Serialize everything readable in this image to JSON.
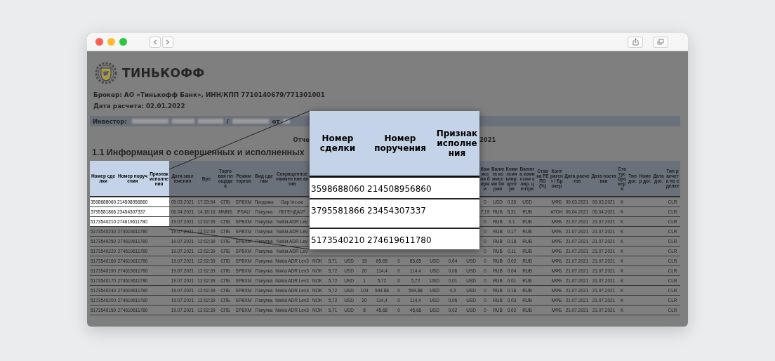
{
  "document": {
    "brand": "ТИНЬКОФФ",
    "broker": "Брокер: АО «Тинькофф Банк», ИНН/КПП 7710140679/771301001",
    "settlement_date": "Дата расчета: 02.01.2022",
    "investor": {
      "label": "Инвестор:",
      "separator": "/",
      "from": "от"
    },
    "report_title_start": "Отче",
    "report_title_end": "2021",
    "section_heading": "1.1 Информация о совершенных и исполненных"
  },
  "table": {
    "header": {
      "highlighted": true,
      "deal": "Номер сделки",
      "order": "Номер поручения",
      "sign": "Признак исполнения",
      "date": "Дата заключения",
      "time": "Вре",
      "venue": "Торговая площадка",
      "mode": "Режим торгов",
      "side": "Вид сделки",
      "asset": "Сокращенное наимен ние актив",
      "exch_fee": "Комиссия биржи",
      "exch_cur": "Валюта комиссии биржи",
      "clr_fee": "Комиссия клир. центра",
      "clr_cur": "Валюта комиссии клир. центра",
      "repo": "Ставка РЕПО (%)",
      "counterparty": "Контрагент / Брокер",
      "settle_date": "Дата расчетов",
      "delivery_date": "Дата поставки",
      "status": "Статус брокера",
      "contract_type": "Тип дог.",
      "contract_no": "Номер дог.",
      "contract_date": "Дата дог.",
      "settle_type": "Тип расчета по сделке"
    },
    "rows": [
      {
        "highlighted": true,
        "deal": "3598688060",
        "order": "214508956860",
        "date": "05.03.2021",
        "time": "17:33:54",
        "venue": "СПБ",
        "mode": "SPBXM",
        "side": "Продажа",
        "asset": "Gap Inc-ao",
        "exch_fee": "0",
        "exch_cur": "USD",
        "clr_fee": "0.35",
        "clr_cur": "USD",
        "counterparty": "МФБ",
        "settle_date": "09.03.2021",
        "delivery_date": "09.03.2021",
        "status": "К",
        "settle_type": "CLR"
      },
      {
        "highlighted": true,
        "deal": "3795581866",
        "order": "23454307337",
        "date": "06.04.2021",
        "time": "14:18:16",
        "venue": "ММВБ",
        "mode": "PSAU",
        "side": "Покупка",
        "asset": "ЛЕГЕНДА1Р",
        "exch_fee": "7.19",
        "exch_cur": "RUB",
        "clr_fee": "5.31",
        "clr_cur": "RUB",
        "counterparty": "АТОН",
        "settle_date": "06.04.2021",
        "delivery_date": "06.04.2021",
        "status": "К",
        "settle_type": "CLR"
      },
      {
        "highlighted": true,
        "deal": "5173540210",
        "order": "274619611780",
        "date": "19.07.2021",
        "time": "12:02:39",
        "venue": "СПБ",
        "mode": "SPBXM",
        "side": "Покупка",
        "asset": "Nokia ADR Lev",
        "exch_fee": "0",
        "exch_cur": "RUB",
        "clr_fee": "0.1",
        "clr_cur": "RUB",
        "counterparty": "МФБ",
        "settle_date": "21.07.2021",
        "delivery_date": "21.07.2021",
        "status": "К",
        "settle_type": "CLR"
      },
      {
        "highlighted": false,
        "deal": "5173540230",
        "order": "274619611780",
        "date": "19.07.2021",
        "time": "12:02:39",
        "venue": "СПБ",
        "mode": "SPBXM",
        "side": "Покупка",
        "asset": "Nokia ADR Lev",
        "exch_fee": "0",
        "exch_cur": "RUB",
        "clr_fee": "0.17",
        "clr_cur": "RUB",
        "counterparty": "МФБ",
        "settle_date": "21.07.2021",
        "delivery_date": "21.07.2021",
        "status": "К",
        "settle_type": "CLR"
      },
      {
        "highlighted": false,
        "deal": "5173540250",
        "order": "274619611780",
        "date": "19.07.2021",
        "time": "12:02:39",
        "venue": "СПБ",
        "mode": "SPBXM",
        "side": "Покупка",
        "asset": "Nokia ADR Lev",
        "exch_fee": "0",
        "exch_cur": "RUB",
        "clr_fee": "0.18",
        "clr_cur": "RUB",
        "counterparty": "МФБ",
        "settle_date": "21.07.2021",
        "delivery_date": "21.07.2021",
        "status": "К",
        "settle_type": "CLR"
      },
      {
        "highlighted": false,
        "deal": "5173540220",
        "order": "274619611780",
        "date": "19.07.2021",
        "time": "12:02:39",
        "venue": "СПБ",
        "mode": "SPBXM",
        "side": "Покупка",
        "asset": "Nokia ADR Lev",
        "exch_fee": "0",
        "exch_cur": "RUB",
        "clr_fee": "0.11",
        "clr_cur": "RUB",
        "counterparty": "МФБ",
        "settle_date": "21.07.2021",
        "delivery_date": "21.07.2021",
        "status": "К",
        "settle_type": "CLR"
      },
      {
        "highlighted": false,
        "deal": "5173540160",
        "order": "274619611780",
        "date": "19.07.2021",
        "time": "12:02:39",
        "venue": "СПБ",
        "mode": "SPBXM",
        "side": "Покупка",
        "asset": "Nokia ADR Lev3",
        "code": "NOK",
        "price": "5,71",
        "price_cur": "USD",
        "qty": "15",
        "amount": "85,65",
        "nkd": "0",
        "deal_sum": "85,65",
        "settle_cur": "USD",
        "broker_fee": "0,04",
        "broker_fee_cur": "USD",
        "exch_fee": "0",
        "exch_cur": "RUB",
        "clr_fee": "0.02",
        "clr_cur": "RUB",
        "counterparty": "МФБ",
        "settle_date": "21.07.2021",
        "delivery_date": "21.07.2021",
        "status": "К",
        "settle_type": "CLR"
      },
      {
        "highlighted": false,
        "deal": "5173540190",
        "order": "274619611780",
        "date": "19.07.2021",
        "time": "12:02:39",
        "venue": "СПБ",
        "mode": "SPBXM",
        "side": "Покупка",
        "asset": "Nokia ADR Lev3",
        "code": "NOK",
        "price": "5,72",
        "price_cur": "USD",
        "qty": "20",
        "amount": "114,4",
        "nkd": "0",
        "deal_sum": "114,4",
        "settle_cur": "USD",
        "broker_fee": "0,06",
        "broker_fee_cur": "USD",
        "exch_fee": "0",
        "exch_cur": "RUB",
        "clr_fee": "0.04",
        "clr_cur": "RUB",
        "counterparty": "МФБ",
        "settle_date": "21.07.2021",
        "delivery_date": "21.07.2021",
        "status": "К",
        "settle_type": "CLR"
      },
      {
        "highlighted": false,
        "deal": "5173540170",
        "order": "274619611780",
        "date": "19.07.2021",
        "time": "12:02:39",
        "venue": "СПБ",
        "mode": "SPBXM",
        "side": "Покупка",
        "asset": "Nokia ADR Lev3",
        "code": "NOK",
        "price": "5,72",
        "price_cur": "USD",
        "qty": "1",
        "amount": "5,72",
        "nkd": "0",
        "deal_sum": "5,72",
        "settle_cur": "USD",
        "broker_fee": "0,01",
        "broker_fee_cur": "USD",
        "exch_fee": "0",
        "exch_cur": "RUB",
        "clr_fee": "0.01",
        "clr_cur": "RUB",
        "counterparty": "МФБ",
        "settle_date": "21.07.2021",
        "delivery_date": "21.07.2021",
        "status": "К",
        "settle_type": "CLR"
      },
      {
        "highlighted": false,
        "deal": "5173540240",
        "order": "274619611780",
        "date": "19.07.2021",
        "time": "12:02:39",
        "venue": "СПБ",
        "mode": "SPBXM",
        "side": "Покупка",
        "asset": "Nokia ADR Lev3",
        "code": "NOK",
        "price": "5,72",
        "price_cur": "USD",
        "qty": "104",
        "amount": "594.88",
        "nkd": "0",
        "deal_sum": "594,88",
        "settle_cur": "USD",
        "broker_fee": "0,3",
        "broker_fee_cur": "USD",
        "exch_fee": "0",
        "exch_cur": "RUB",
        "clr_fee": "0.18",
        "clr_cur": "RUB",
        "counterparty": "МФБ",
        "settle_date": "21.07.2021",
        "delivery_date": "21.07.2021",
        "status": "К",
        "settle_type": "CLR"
      },
      {
        "highlighted": false,
        "deal": "5173540200",
        "order": "274619611780",
        "date": "19.07.2021",
        "time": "12:02:39",
        "venue": "СПБ",
        "mode": "SPBXM",
        "side": "Покупка",
        "asset": "Nokia ADR Lev3",
        "code": "NOK",
        "price": "5,72",
        "price_cur": "USD",
        "qty": "20",
        "amount": "114,4",
        "nkd": "0",
        "deal_sum": "114,4",
        "settle_cur": "USD",
        "broker_fee": "0,06",
        "broker_fee_cur": "USD",
        "exch_fee": "0",
        "exch_cur": "RUB",
        "clr_fee": "0.03",
        "clr_cur": "RUB",
        "counterparty": "МФБ",
        "settle_date": "21.07.2021",
        "delivery_date": "21.07.2021",
        "status": "К",
        "settle_type": "CLR"
      },
      {
        "highlighted": false,
        "deal": "5173540150",
        "order": "274619611780",
        "date": "19.07.2021",
        "time": "12:02:39",
        "venue": "СПБ",
        "mode": "SPBXM",
        "side": "Покупка",
        "asset": "Nokia ADR Lev3",
        "code": "NOK",
        "price": "5,71",
        "price_cur": "USD",
        "qty": "8",
        "amount": "45,68",
        "nkd": "0",
        "deal_sum": "45,68",
        "settle_cur": "USD",
        "broker_fee": "0,02",
        "broker_fee_cur": "USD",
        "exch_fee": "0",
        "exch_cur": "RUB",
        "clr_fee": "0.02",
        "clr_cur": "RUB",
        "counterparty": "МФБ",
        "settle_date": "21.07.2021",
        "delivery_date": "21.07.2021",
        "status": "К",
        "settle_type": "CLR"
      }
    ]
  },
  "magnifier": {
    "header": [
      "Номер сделки",
      "Номер поручения",
      "Признак исполнения"
    ],
    "rows": [
      [
        "3598688060",
        "214508956860"
      ],
      [
        "3795581866",
        "23454307337"
      ],
      [
        "5173540210",
        "274619611780"
      ]
    ]
  }
}
